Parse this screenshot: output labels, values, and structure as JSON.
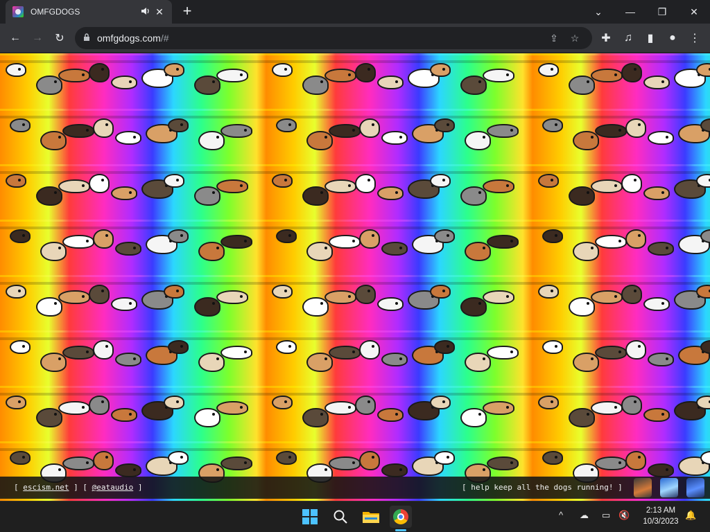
{
  "window": {
    "tab_title": "OMFGDOGS",
    "tab_audio_icon": "speaker-icon",
    "tab_close_glyph": "✕",
    "new_tab_glyph": "+",
    "controls": {
      "dropdown": "⌄",
      "minimize": "—",
      "restore": "❐",
      "close": "✕"
    }
  },
  "toolbar": {
    "back": "←",
    "forward": "→",
    "reload": "↻",
    "lock_glyph": "🔒",
    "url_host": "omfgdogs.com",
    "url_path": "/#",
    "share_glyph": "⇪",
    "star_glyph": "☆",
    "extensions_glyph": "✚",
    "media_glyph": "♫",
    "sidepanel_glyph": "▮",
    "profile_glyph": "●",
    "menu_glyph": "⋮"
  },
  "page": {
    "footer": {
      "left_open": "[ ",
      "link1": "escism.net",
      "left_mid": " ] [ ",
      "link2": "@eataudio",
      "left_close": " ]",
      "right_text": "[ help keep all the dogs running! ]"
    }
  },
  "taskbar": {
    "icons": [
      "windows-start-icon",
      "search-icon",
      "file-explorer-icon",
      "chrome-icon"
    ],
    "tray": {
      "chevron": "^",
      "onedrive": "☁",
      "network": "▭",
      "volume": "🔇",
      "notifications": "🔔"
    },
    "time": "2:13 AM",
    "date": "10/3/2023"
  },
  "colors": {
    "chrome_dark": "#202124",
    "chrome_toolbar": "#35363a",
    "windows_accent": "#4cc2ff"
  }
}
